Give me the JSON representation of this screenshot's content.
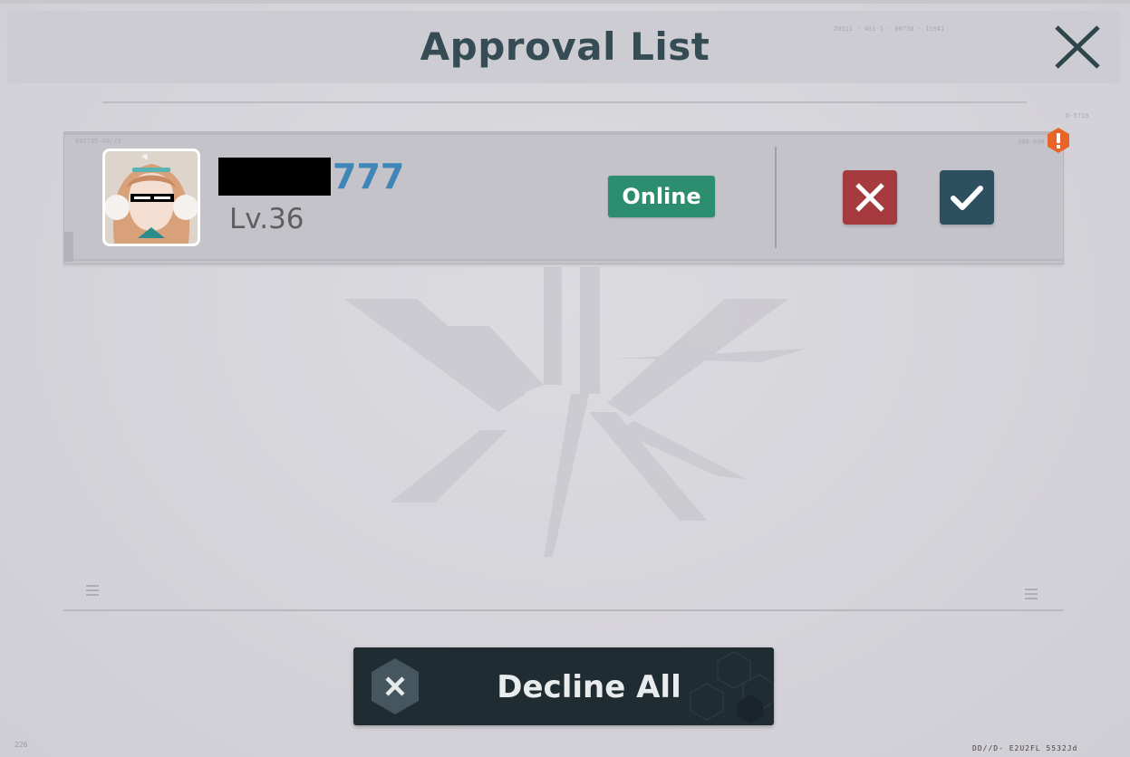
{
  "header": {
    "title": "Approval List",
    "code_text": "20311 · 401-1 · 00730 · 11041"
  },
  "card": {
    "serial": "092735-A0//3",
    "code_right": "300-890",
    "code_top": "D-5710",
    "username_visible": "777",
    "level": "Lv.36",
    "status": "Online"
  },
  "footer": {
    "decline_all_label": "Decline All",
    "corner_number": "226",
    "corner_code": "DD//D- E2U2FL  5532Jd"
  },
  "colors": {
    "accent_blue": "#3e86b7",
    "online_green": "#2d8d6f",
    "decline_red": "#a63b3f",
    "accept_slate": "#2e4f5f",
    "alert_orange": "#e8652a",
    "dark_button": "#1f2c32"
  },
  "icons": {
    "close": "close-icon",
    "decline": "x-icon",
    "accept": "checkmark-icon",
    "alert": "exclamation-icon",
    "decline_all": "x-hexagon-icon"
  }
}
